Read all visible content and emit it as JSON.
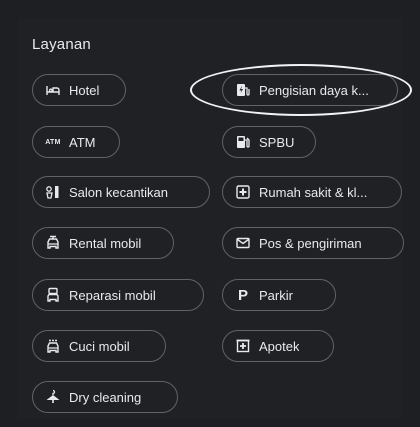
{
  "section": {
    "title": "Layanan"
  },
  "chips": {
    "hotel": {
      "label": "Hotel",
      "icon": "hotel-bed-icon"
    },
    "charging": {
      "label": "Pengisian daya k...",
      "icon": "ev-charging-icon"
    },
    "atm": {
      "label": "ATM",
      "icon": "atm-icon"
    },
    "spbu": {
      "label": "SPBU",
      "icon": "gas-station-icon"
    },
    "salon": {
      "label": "Salon kecantikan",
      "icon": "salon-icon"
    },
    "hospital": {
      "label": "Rumah sakit & kl...",
      "icon": "hospital-icon"
    },
    "rental": {
      "label": "Rental mobil",
      "icon": "car-rental-icon"
    },
    "post": {
      "label": "Pos & pengiriman",
      "icon": "mail-icon"
    },
    "repair": {
      "label": "Reparasi mobil",
      "icon": "car-repair-icon"
    },
    "parking": {
      "label": "Parkir",
      "icon": "parking-icon"
    },
    "carwash": {
      "label": "Cuci mobil",
      "icon": "car-wash-icon"
    },
    "pharmacy": {
      "label": "Apotek",
      "icon": "pharmacy-icon"
    },
    "drycleaning": {
      "label": "Dry cleaning",
      "icon": "dry-cleaning-icon"
    }
  },
  "colors": {
    "background": "#202124",
    "chip_border": "#5f6368",
    "text": "#e8eaed",
    "highlight": "#f1f3f4"
  }
}
